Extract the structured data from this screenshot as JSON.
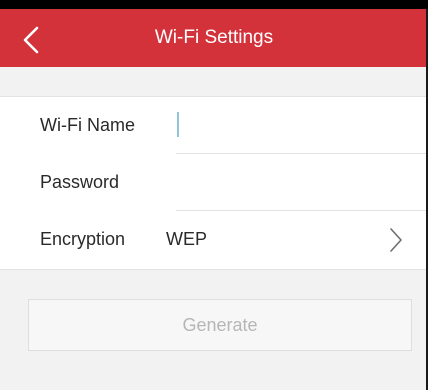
{
  "header": {
    "title": "Wi-Fi Settings",
    "back_icon": "chevron-left-icon"
  },
  "form": {
    "wifi_name": {
      "label": "Wi-Fi Name",
      "value": ""
    },
    "password": {
      "label": "Password",
      "value": ""
    },
    "encryption": {
      "label": "Encryption",
      "value": "WEP",
      "icon": "chevron-right-icon"
    }
  },
  "actions": {
    "generate_label": "Generate",
    "generate_enabled": false
  },
  "colors": {
    "header_bg": "#d3323b",
    "page_bg": "#f2f2f2",
    "card_bg": "#ffffff",
    "disabled_text": "#b6b6b6",
    "caret": "#8fc6d9"
  }
}
